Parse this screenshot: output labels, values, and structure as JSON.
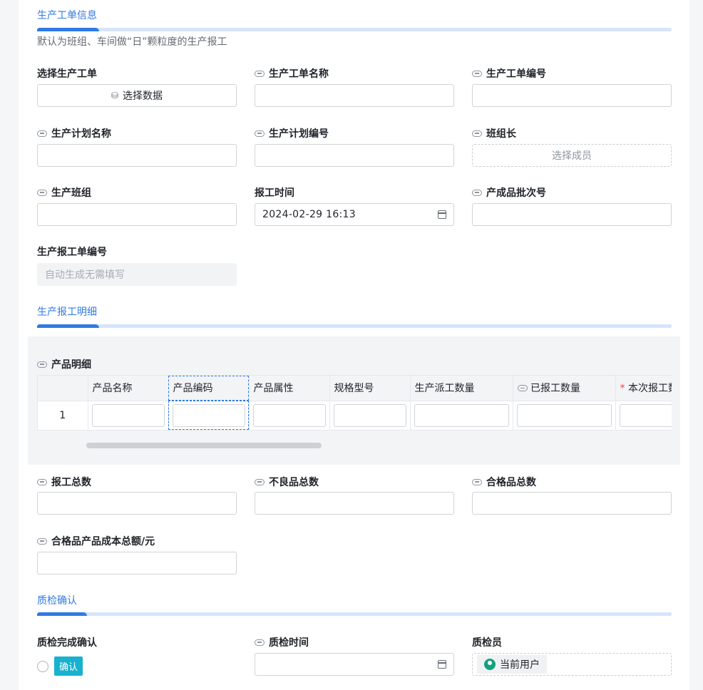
{
  "sections": {
    "info": "生产工单信息",
    "detail": "生产报工明细",
    "qc": "质检确认"
  },
  "info_desc": "默认为班组、车间做“日”颗粒度的生产报工",
  "fields": {
    "select_order": {
      "label": "选择生产工单",
      "button": "选择数据"
    },
    "order_name": {
      "label": "生产工单名称",
      "value": ""
    },
    "order_no": {
      "label": "生产工单编号",
      "value": ""
    },
    "plan_name": {
      "label": "生产计划名称",
      "value": ""
    },
    "plan_no": {
      "label": "生产计划编号",
      "value": ""
    },
    "leader": {
      "label": "班组长",
      "placeholder": "选择成员"
    },
    "team": {
      "label": "生产班组",
      "value": ""
    },
    "report_time": {
      "label": "报工时间",
      "value": "2024-02-29 16:13"
    },
    "batch_no": {
      "label": "产成品批次号",
      "value": ""
    },
    "report_no": {
      "label": "生产报工单编号",
      "placeholder": "自动生成无需填写"
    },
    "total": {
      "label": "报工总数"
    },
    "defect": {
      "label": "不良品总数"
    },
    "qualified": {
      "label": "合格品总数"
    },
    "cost": {
      "label": "合格品产品成本总额/元"
    },
    "qc_confirm": {
      "label": "质检完成确认",
      "tag": "确认"
    },
    "qc_time": {
      "label": "质检时间"
    },
    "inspector": {
      "label": "质检员",
      "value": "当前用户"
    }
  },
  "table": {
    "title": "产品明细",
    "columns": [
      "产品名称",
      "产品编码",
      "产品属性",
      "规格型号",
      "生产派工数量",
      "已报工数量",
      "本次报工数"
    ],
    "rows": [
      {
        "index": "1"
      }
    ]
  },
  "colors": {
    "accent": "#2f7ae5",
    "tag": "#18b1cf"
  }
}
